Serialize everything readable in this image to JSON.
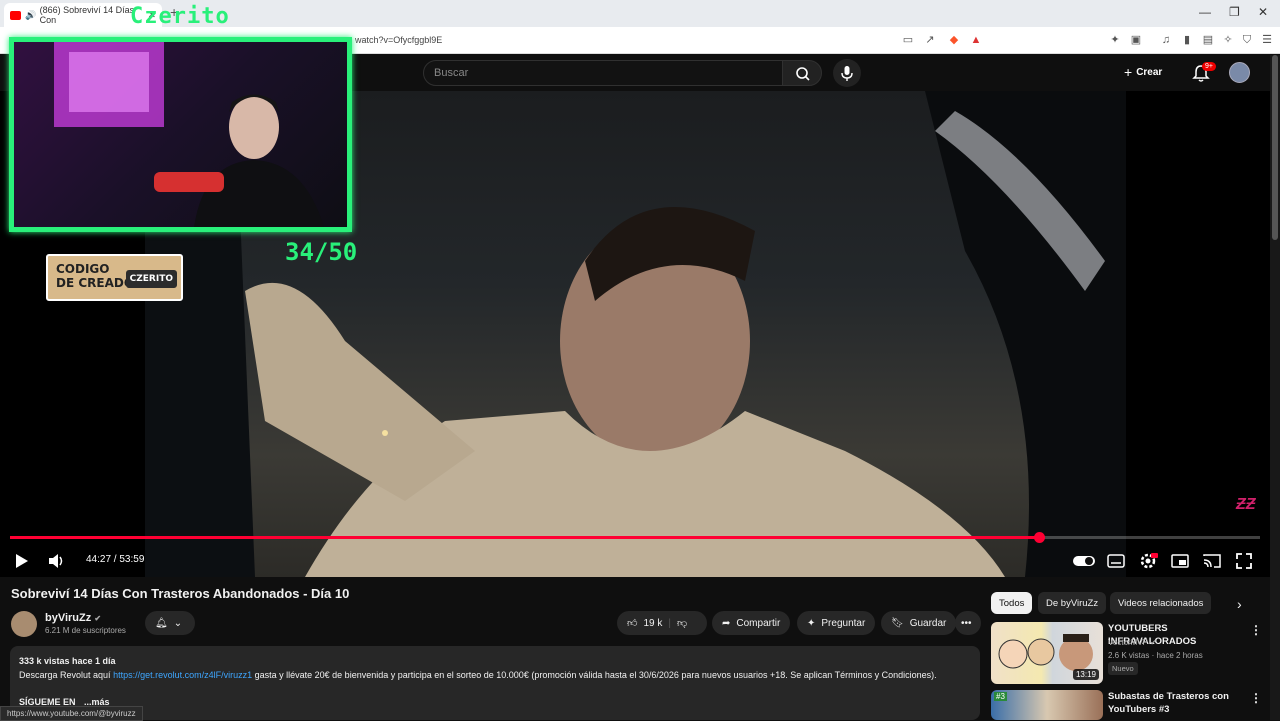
{
  "browser": {
    "tab_title": "(866) Sobreviví 14 Días Con",
    "url": "watch?v=Ofycfggbl9E",
    "status_url": "https://www.youtube.com/@byviruzz"
  },
  "masthead": {
    "search_placeholder": "Buscar",
    "create_label": "Crear",
    "notif_badge": "9+"
  },
  "player": {
    "time_current": "44:27",
    "time_total": "53:59",
    "time_display": "44:27 / 53:59",
    "progress_fraction": 0.823
  },
  "overlay": {
    "streamer_name": "Czerito",
    "counter": "34/50",
    "code_line1": "CODIGO",
    "code_line2": "DE CREADOR",
    "code_tag": "CZERITO"
  },
  "video": {
    "title": "Sobreviví 14 Días Con Trasteros Abandonados - Día 10",
    "channel_name": "byViruZz",
    "subscribers": "6.21 M de suscriptores",
    "likes": "19 k",
    "share_label": "Compartir",
    "ask_label": "Preguntar",
    "save_label": "Guardar"
  },
  "description": {
    "meta": "333 k vistas  hace 1 día",
    "line_prefix": "Descarga Revolut aquí ",
    "link": "https://get.revolut.com/z4lF/viruzz1",
    "line_suffix": " gasta y llévate 20€ de bienvenida y participa en el sorteo de 10.000€ (promoción válida hasta el 30/6/2026 para nuevos usuarios +18. Se aplican Términos y Condiciones).",
    "follow": "SÍGUEME EN",
    "more": "...más"
  },
  "sidebar": {
    "chips": [
      "Todos",
      "De byViruZz",
      "Videos relacionados"
    ],
    "recommendations": [
      {
        "title": "YOUTUBERS INFRAVALORADOS",
        "channel": "VectorMVP",
        "meta": "2.6 K vistas · hace 2 horas",
        "badge": "Nuevo",
        "duration": "13:19"
      },
      {
        "title": "Subastas de Trasteros con YouTubers #3",
        "channel": "",
        "meta": "",
        "badge": "",
        "duration": ""
      }
    ]
  },
  "colors": {
    "progress": "#ff0033",
    "overlay_green": "#29f07a",
    "link": "#3ea6ff"
  }
}
